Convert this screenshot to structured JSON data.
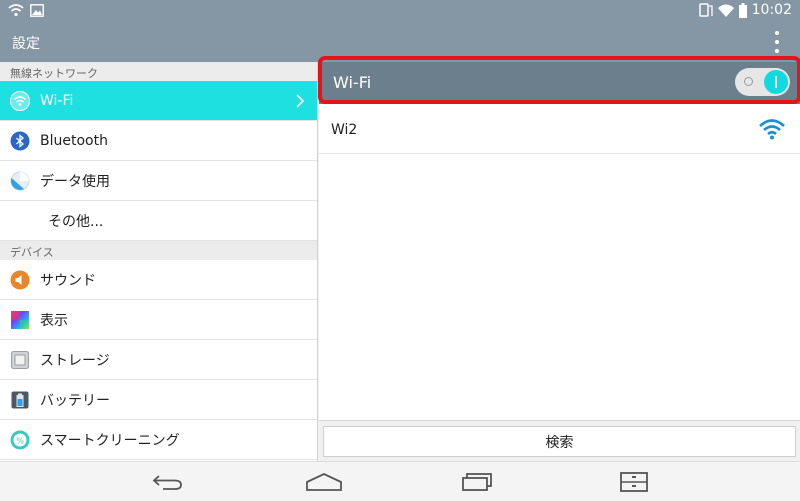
{
  "status_bar": {
    "time": "10:02",
    "left_icons": [
      "wifi-icon",
      "image-icon"
    ],
    "right_icons": [
      "rotate-icon",
      "wifi-signal-icon",
      "battery-icon"
    ]
  },
  "action_bar": {
    "title": "設定",
    "overflow_icon": "more-vertical-icon"
  },
  "sidebar": {
    "sections": [
      {
        "header": "無線ネットワーク",
        "items": [
          {
            "label": "Wi-Fi",
            "icon": "wifi-icon",
            "active": true
          },
          {
            "label": "Bluetooth",
            "icon": "bluetooth-icon"
          },
          {
            "label": "データ使用",
            "icon": "data-usage-icon"
          },
          {
            "label": "その他...",
            "icon": ""
          }
        ]
      },
      {
        "header": "デバイス",
        "items": [
          {
            "label": "サウンド",
            "icon": "sound-icon"
          },
          {
            "label": "表示",
            "icon": "display-icon"
          },
          {
            "label": "ストレージ",
            "icon": "storage-icon"
          },
          {
            "label": "バッテリー",
            "icon": "battery-icon"
          },
          {
            "label": "スマートクリーニング",
            "icon": "smart-cleaning-icon"
          }
        ]
      }
    ]
  },
  "detail": {
    "header_label": "Wi-Fi",
    "toggle_on": true,
    "networks": [
      {
        "name": "Wi2",
        "signal_icon": "wifi-signal-icon"
      }
    ],
    "scan_label": "検索"
  },
  "nav_bar": {
    "icons": [
      "back-icon",
      "home-icon",
      "recents-icon",
      "menu-icon"
    ]
  },
  "colors": {
    "action_bar": "#8597a5",
    "active_item": "#1fe0e0",
    "toggle_on": "#10d9e0",
    "highlight": "#e5141b"
  }
}
